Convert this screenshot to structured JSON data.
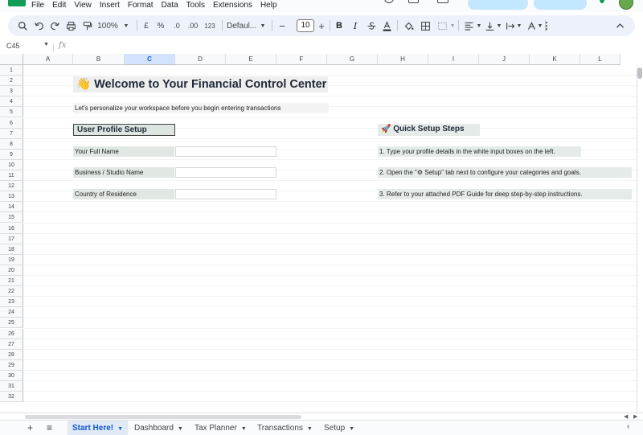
{
  "menu": [
    "File",
    "Edit",
    "View",
    "Insert",
    "Format",
    "Data",
    "Tools",
    "Extensions",
    "Help"
  ],
  "toolbar": {
    "zoom": "100%",
    "currency": "£",
    "percent": "%",
    "dec_decrease": ".0",
    "dec_increase": ".00",
    "number_format": "123",
    "font_name": "Defaul...",
    "font_size": "10",
    "bold": "B",
    "italic": "I",
    "more": "⋮"
  },
  "formula_bar": {
    "cell_ref": "C45",
    "fx": "fx"
  },
  "columns": [
    "A",
    "B",
    "C",
    "D",
    "E",
    "F",
    "G",
    "H",
    "I",
    "J",
    "K",
    "L"
  ],
  "selected_column": "C",
  "rows": [
    "1",
    "2",
    "3",
    "4",
    "5",
    "6",
    "7",
    "8",
    "9",
    "10",
    "11",
    "12",
    "13",
    "14",
    "15",
    "16",
    "17",
    "18",
    "19",
    "20",
    "21",
    "22",
    "23",
    "24",
    "25",
    "26",
    "27",
    "28",
    "29",
    "30",
    "31",
    "32"
  ],
  "sheet": {
    "title": "👋 Welcome to Your Financial Control Center",
    "subtitle": "Let's personalize your workspace before you begin entering transactions",
    "profile_heading": "User Profile Setup",
    "profile_fields": [
      {
        "label": "Your Full Name",
        "value": ""
      },
      {
        "label": "Business / Studio Name",
        "value": ""
      },
      {
        "label": "Country of Residence",
        "value": ""
      }
    ],
    "steps_heading": "🚀 Quick Setup Steps",
    "steps": [
      "1. Type your profile details in the white input boxes on the left.",
      "2. Open the \"⚙ Setup\" tab next to configure your categories and goals.",
      "3. Refer to your attached PDF Guide for deep step-by-step instructions."
    ]
  },
  "tabs": [
    {
      "label": "Start Here!",
      "active": true
    },
    {
      "label": "Dashboard",
      "active": false
    },
    {
      "label": "Tax Planner",
      "active": false
    },
    {
      "label": "Transactions",
      "active": false
    },
    {
      "label": "Setup",
      "active": false
    }
  ],
  "colors": {
    "accent": "#0b57d0",
    "label_fill": "#e1e8e4",
    "title_fill": "#eeeeee",
    "app_green": "#0f9d58"
  }
}
